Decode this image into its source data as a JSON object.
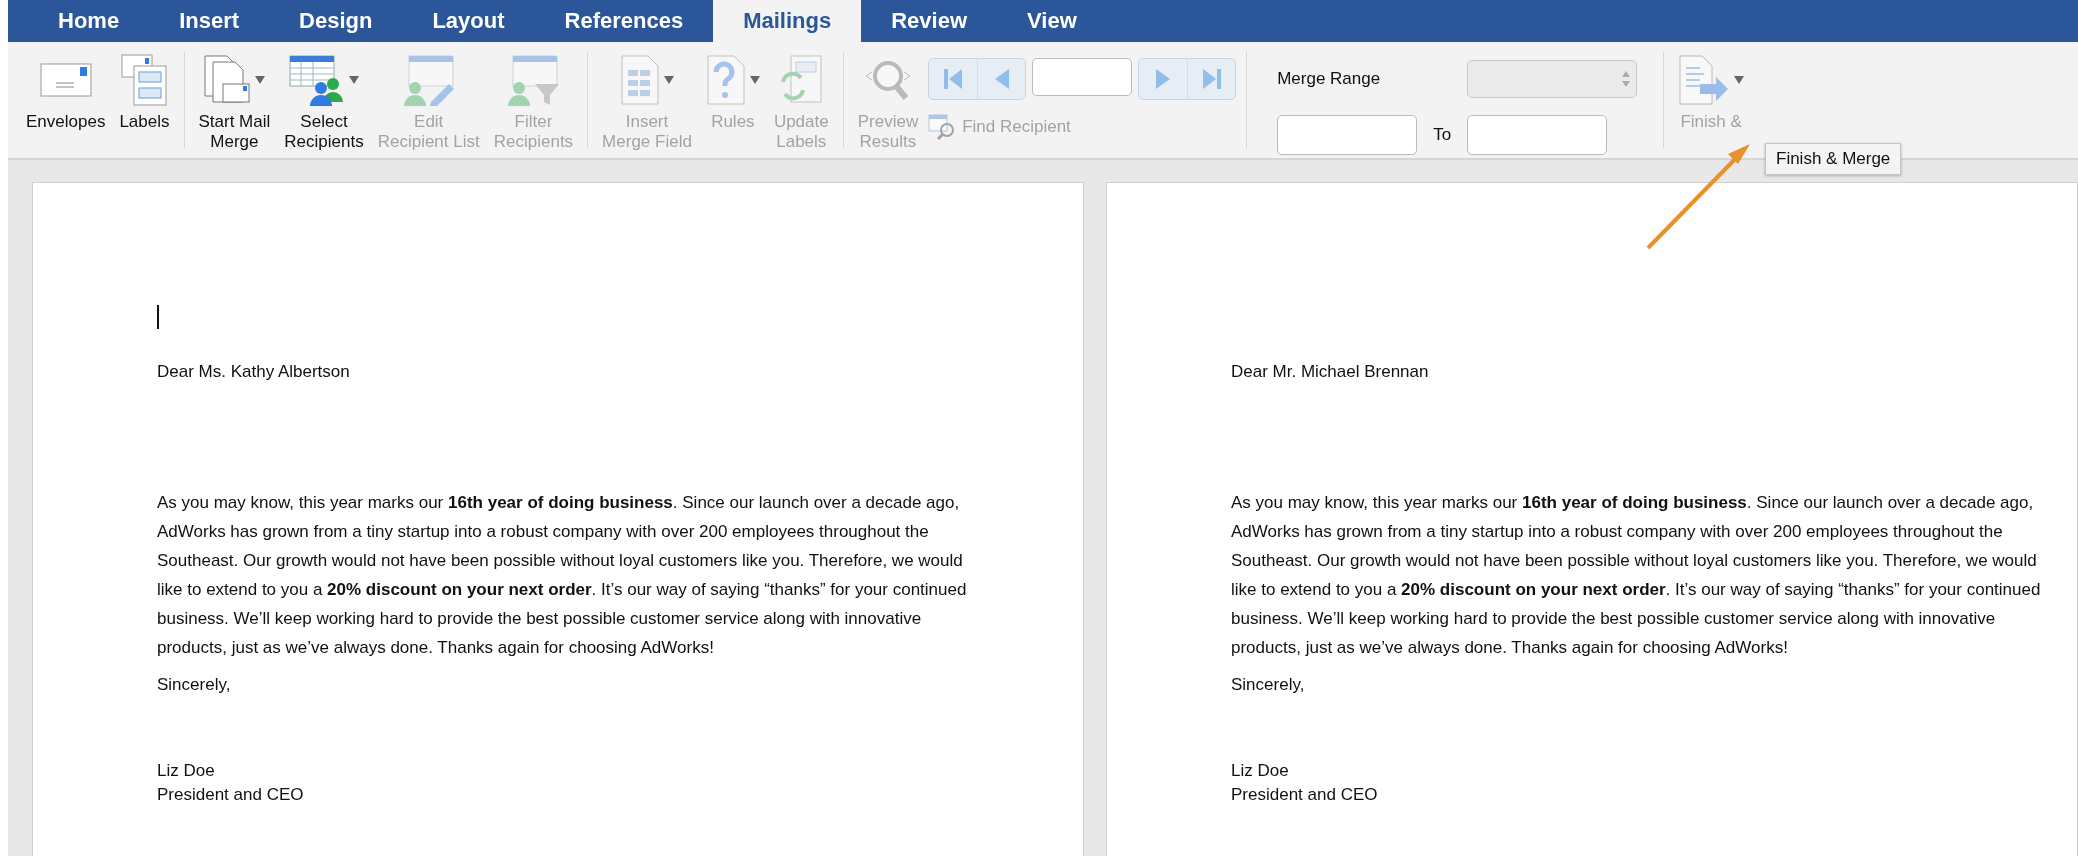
{
  "tabs": [
    {
      "label": "Home",
      "selected": false
    },
    {
      "label": "Insert",
      "selected": false
    },
    {
      "label": "Design",
      "selected": false
    },
    {
      "label": "Layout",
      "selected": false
    },
    {
      "label": "References",
      "selected": false
    },
    {
      "label": "Mailings",
      "selected": true
    },
    {
      "label": "Review",
      "selected": false
    },
    {
      "label": "View",
      "selected": false
    }
  ],
  "ribbon": {
    "groups": [
      [
        {
          "kind": "envelope",
          "label": "Envelopes",
          "disabled": false,
          "dropdown": false
        },
        {
          "kind": "labels",
          "label": "Labels",
          "disabled": false,
          "dropdown": false
        }
      ],
      [
        {
          "kind": "mail-merge",
          "label": "Start Mail\nMerge",
          "disabled": false,
          "dropdown": true
        },
        {
          "kind": "recipients",
          "label": "Select\nRecipients",
          "disabled": false,
          "dropdown": true
        },
        {
          "kind": "edit-list",
          "label": "Edit\nRecipient List",
          "disabled": true,
          "dropdown": false
        },
        {
          "kind": "filter",
          "label": "Filter\nRecipients",
          "disabled": true,
          "dropdown": false
        }
      ],
      [
        {
          "kind": "merge-field",
          "label": "Insert\nMerge Field",
          "disabled": true,
          "dropdown": true
        },
        {
          "kind": "rules",
          "label": "Rules",
          "disabled": true,
          "dropdown": true
        },
        {
          "kind": "update",
          "label": "Update\nLabels",
          "disabled": true,
          "dropdown": false
        }
      ]
    ],
    "preview": {
      "label": "Preview\nResults",
      "disabled": true
    },
    "navigation": [
      {
        "kind": "first",
        "disabled": true
      },
      {
        "kind": "previous",
        "disabled": true
      },
      {
        "kind": "next",
        "disabled": true
      },
      {
        "kind": "last",
        "disabled": true
      }
    ],
    "find_recipient": {
      "label": "Find Recipient",
      "disabled": true
    },
    "merge_range": {
      "label": "Merge Range",
      "to_label": "To"
    },
    "finish": {
      "label": "Finish &",
      "disabled": true,
      "dropdown": true
    },
    "tooltip": "Finish & Merge"
  },
  "pages": [
    {
      "cursor": true,
      "salutation": "Dear Ms. Kathy Albertson",
      "body": "As you may know, this year marks our **16th year of doing business**. Since our launch over a decade ago, AdWorks has grown from a tiny startup into a robust company with over 200 employees throughout the Southeast. Our growth would not have been possible without loyal customers like you. Therefore, we would like to extend to you a **20% discount on your next order**. It’s our way of saying “thanks” for your continued business. We’ll keep working hard to provide the best possible customer service along with innovative products, just as we’ve always done. Thanks again for choosing AdWorks!",
      "closing": "Sincerely,",
      "signer": "Liz Doe",
      "signer_title": "President and CEO"
    },
    {
      "cursor": false,
      "salutation": "Dear Mr. Michael Brennan",
      "body": "As you may know, this year marks our **16th year of doing business**. Since our launch over a decade ago, AdWorks has grown from a tiny startup into a robust company with over 200 employees throughout the Southeast. Our growth would not have been possible without loyal customers like you. Therefore, we would like to extend to you a **20% discount on your next order**. It’s our way of saying “thanks” for your continued business. We’ll keep working hard to provide the best possible customer service along with innovative products, just as we’ve always done. Thanks again for choosing AdWorks!",
      "closing": "Sincerely,",
      "signer": "Liz Doe",
      "signer_title": "President and CEO"
    }
  ]
}
